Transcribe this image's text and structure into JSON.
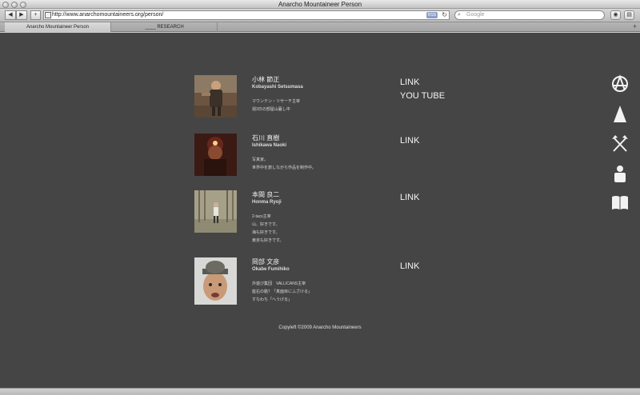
{
  "window": {
    "title": "Anarcho Mountaineer Person"
  },
  "toolbar": {
    "back_label": "◀",
    "forward_label": "▶",
    "add_label": "+",
    "url": "http://www.anarchomountaineers.org/person/",
    "rss_label": "RSS",
    "search_placeholder": "Google"
  },
  "tabs": [
    {
      "label": "Anarcho Mountaineer Person"
    },
    {
      "label": "____ RESEARCH"
    }
  ],
  "people": [
    {
      "name_jp": "小林 節正",
      "name_en": "Kobayashi Setsumasa",
      "desc": [
        "マウンテン・リサーチ主宰",
        "週3日の部屋山暮し中"
      ],
      "links": [
        "LINK",
        "YOU TUBE"
      ]
    },
    {
      "name_jp": "石川 直樹",
      "name_en": "Ishikawa Naoki",
      "desc": [
        "写真家。",
        "世界中を旅しながら作品を制作中。"
      ],
      "links": [
        "LINK"
      ]
    },
    {
      "name_jp": "本間 良二",
      "name_en": "Honma Ryoji",
      "desc": [
        "2-tacs主宰",
        "山、好きです。",
        "海も好きです。",
        "東京も好きです。"
      ],
      "links": [
        "LINK"
      ]
    },
    {
      "name_jp": "岡部 文彦",
      "name_en": "Okabe Fumihiko",
      "desc": [
        "外遊び集団　VALLICANS主宰",
        "座右の銘？「真面目にふざける」",
        "すなわち「へうげる」"
      ],
      "links": [
        "LINK"
      ]
    }
  ],
  "footer": "Copyleft ©2009 Anarcho Mountaineers",
  "side_icons": [
    "anarchy-a-icon",
    "mountain-icon",
    "crossed-axes-icon",
    "person-icon",
    "book-icon"
  ],
  "colors": {
    "page_bg": "#454545",
    "text": "#f2f2f2"
  }
}
